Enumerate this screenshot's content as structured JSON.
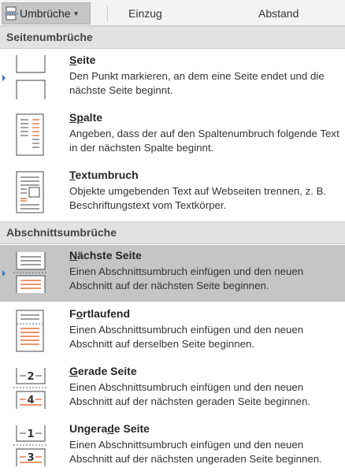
{
  "ribbon": {
    "breaks_button": "Umbrüche",
    "indent_label": "Einzug",
    "spacing_label": "Abstand"
  },
  "sections": {
    "page_breaks": "Seitenumbrüche",
    "section_breaks": "Abschnittsumbrüche"
  },
  "items": [
    {
      "title_mnemonic": "S",
      "title_rest": "eite",
      "description": "Den Punkt markieren, an dem eine Seite endet und die nächste Seite beginnt.",
      "icon": "page-break-icon"
    },
    {
      "title_mnemonic": "Sp",
      "title_rest": "alte",
      "description": "Angeben, dass der auf den Spaltenumbruch folgende Text in der nächsten Spalte beginnt.",
      "icon": "column-break-icon"
    },
    {
      "title_mnemonic": "T",
      "title_rest": "extumbruch",
      "description": "Objekte umgebenden Text auf Webseiten trennen, z. B. Beschriftungstext vom Textkörper.",
      "icon": "text-wrapping-break-icon"
    },
    {
      "title_mnemonic": "N",
      "title_rest": "ächste Seite",
      "description": "Einen Abschnittsumbruch einfügen und den neuen Abschnitt auf der nächsten Seite beginnen.",
      "icon": "next-page-section-break-icon"
    },
    {
      "title_pre": "F",
      "title_mnemonic": "o",
      "title_rest": "rtlaufend",
      "description": "Einen Abschnittsumbruch einfügen und den neuen Abschnitt auf derselben Seite beginnen.",
      "icon": "continuous-section-break-icon"
    },
    {
      "title_mnemonic": "G",
      "title_rest": "erade Seite",
      "description": "Einen Abschnittsumbruch einfügen und den neuen Abschnitt auf der nächsten geraden Seite beginnen.",
      "icon": "even-page-section-break-icon",
      "page_numbers": [
        "2",
        "4"
      ]
    },
    {
      "title_pre": "Ungera",
      "title_mnemonic": "d",
      "title_rest": "e Seite",
      "description": "Einen Abschnittsumbruch einfügen und den neuen Abschnitt auf der nächsten ungeraden Seite beginnen.",
      "icon": "odd-page-section-break-icon",
      "page_numbers": [
        "1",
        "3"
      ]
    }
  ],
  "colors": {
    "accent_orange": "#e8743b",
    "selected_bg": "#c5c5c5",
    "header_bg": "#e2e2e2",
    "marker_blue": "#3a74c4"
  }
}
